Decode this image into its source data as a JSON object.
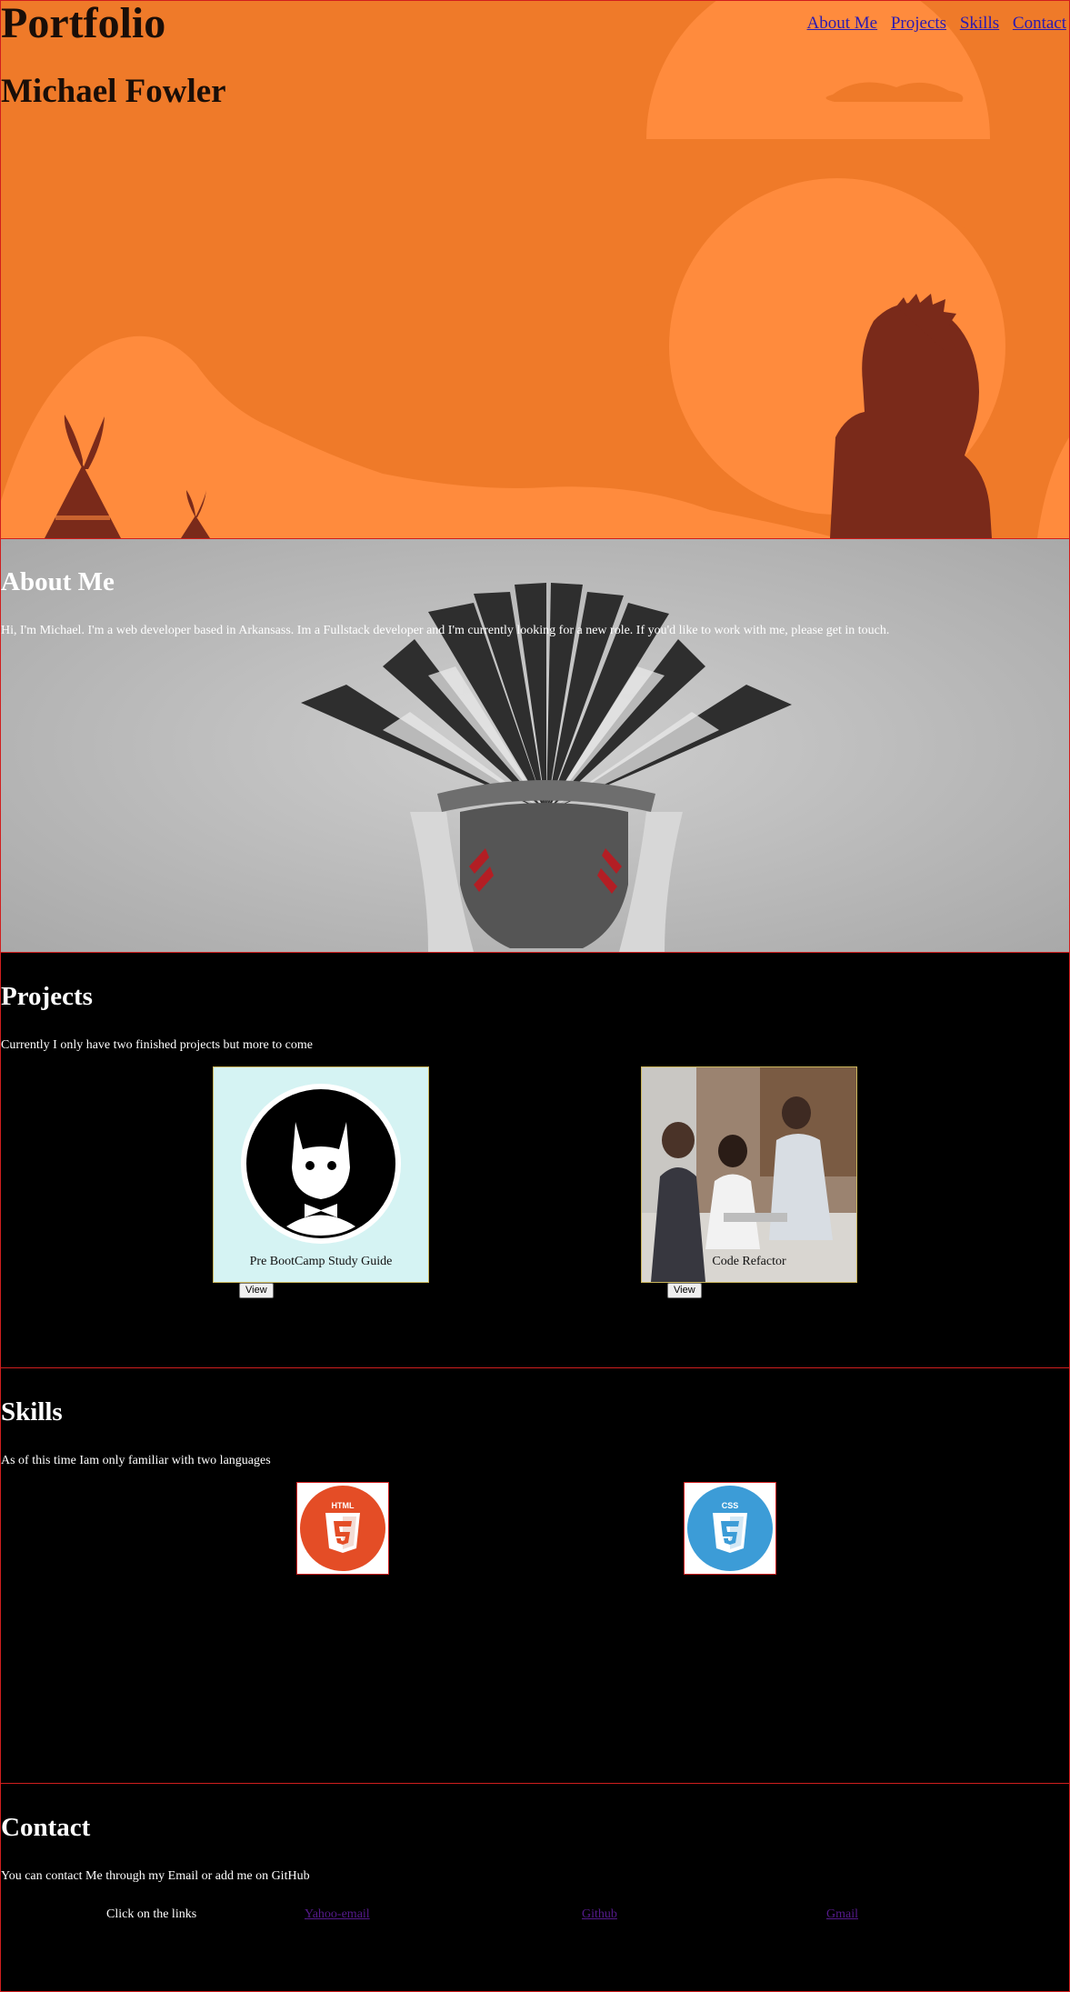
{
  "header": {
    "logo": "Portfolio",
    "name": "Michael Fowler",
    "nav": [
      "About Me",
      "Projects",
      "Skills",
      "Contact"
    ]
  },
  "about": {
    "title": "About Me",
    "text": "Hi, I'm Michael. I'm a web developer based in Arkansass. Im a Fullstack developer and I'm currently looking for a new role. If you'd like to work with me, please get in touch."
  },
  "projects": {
    "title": "Projects",
    "text": "Currently I only have two finished projects but more to come",
    "items": [
      {
        "caption": "Pre BootCamp Study Guide",
        "button": "View"
      },
      {
        "caption": "Code Refactor",
        "button": "View"
      }
    ]
  },
  "skills": {
    "title": "Skills",
    "text": "As of this time Iam only familiar with two languages",
    "items": [
      {
        "logo": "HTML",
        "icon": "html5-logo-icon",
        "color": "#e44d26"
      },
      {
        "logo": "CSS",
        "icon": "css3-logo-icon",
        "color": "#3c9cd7"
      }
    ]
  },
  "contact": {
    "title": "Contact",
    "text": "You can contact Me through my Email or add me on GitHub",
    "prompt": "Click on the links",
    "links": [
      "Yahoo-email",
      "Github",
      "Gmail"
    ]
  },
  "colors": {
    "header_bg": "#ef7a29",
    "hero_shape": "#ff8b3d",
    "silhouette": "#7a2a1a",
    "section_border": "#d01e1e",
    "link": "#551a8b"
  }
}
